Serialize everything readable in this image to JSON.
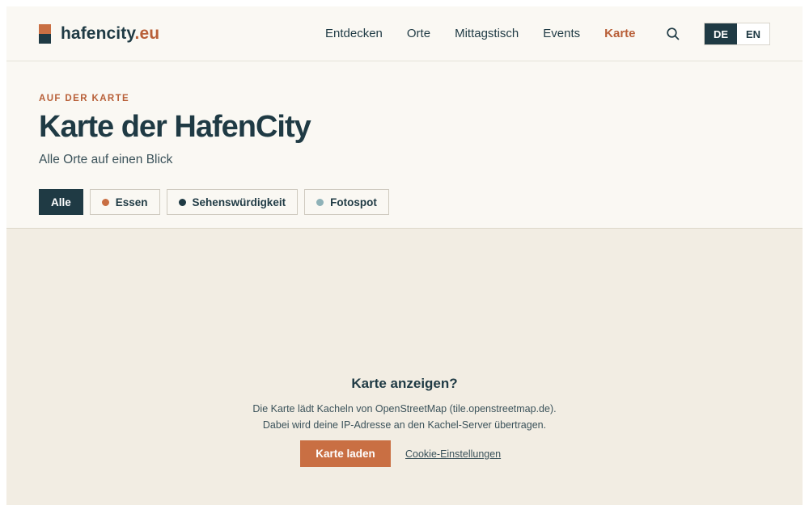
{
  "header": {
    "logo_name": "hafencity",
    "logo_tld": ".eu",
    "nav": [
      {
        "label": "Entdecken",
        "active": false
      },
      {
        "label": "Orte",
        "active": false
      },
      {
        "label": "Mittagstisch",
        "active": false
      },
      {
        "label": "Events",
        "active": false
      },
      {
        "label": "Karte",
        "active": true
      }
    ],
    "search_icon": "search-icon",
    "languages": [
      {
        "label": "DE",
        "active": true
      },
      {
        "label": "EN",
        "active": false
      }
    ]
  },
  "hero": {
    "kicker": "AUF DER KARTE",
    "title": "Karte der HafenCity",
    "subtitle": "Alle Orte auf einen Blick"
  },
  "filters": [
    {
      "label": "Alle",
      "active": true,
      "dot_color": null
    },
    {
      "label": "Essen",
      "active": false,
      "dot_color": "#c96f43"
    },
    {
      "label": "Sehenswürdigkeit",
      "active": false,
      "dot_color": "#1f3a44"
    },
    {
      "label": "Fotospot",
      "active": false,
      "dot_color": "#8fb2b8"
    }
  ],
  "map_consent": {
    "title": "Karte anzeigen?",
    "line1": "Die Karte lädt Kacheln von OpenStreetMap (tile.openstreetmap.de).",
    "line2": "Dabei wird deine IP-Adresse an den Kachel-Server übertragen.",
    "load_button": "Karte laden",
    "cookie_link": "Cookie-Einstellungen"
  },
  "colors": {
    "primary": "#1f3a44",
    "accent": "#c96f43",
    "background": "#faf8f3",
    "map_background": "#f2ede3"
  }
}
